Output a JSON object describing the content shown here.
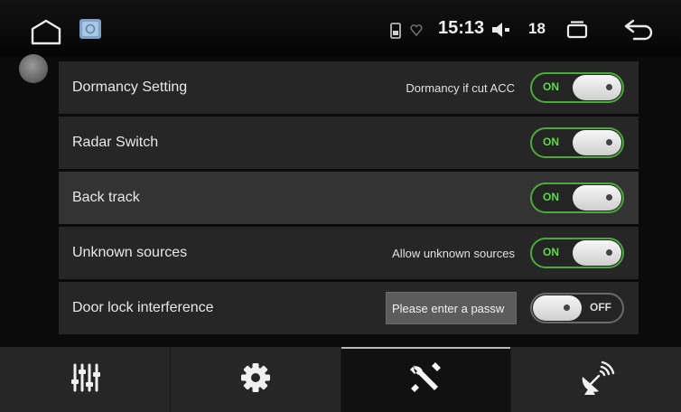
{
  "status_bar": {
    "time": "15:13",
    "volume": "18",
    "icons": [
      "home-icon",
      "app-icon",
      "sim-icon",
      "heart-icon",
      "speaker-icon",
      "recent-apps-icon",
      "back-icon"
    ]
  },
  "settings": {
    "rows": [
      {
        "label": "Dormancy Setting",
        "hint": "Dormancy if cut ACC",
        "toggle": "ON"
      },
      {
        "label": "Radar Switch",
        "toggle": "ON"
      },
      {
        "label": "Back track",
        "toggle": "ON"
      },
      {
        "label": "Unknown sources",
        "hint": "Allow unknown sources",
        "toggle": "ON"
      },
      {
        "label": "Door lock interference",
        "placeholder": "Please enter a passw",
        "toggle": "OFF"
      }
    ]
  },
  "tabs": [
    {
      "icon": "equalizer-icon"
    },
    {
      "icon": "gear-icon"
    },
    {
      "icon": "tools-icon"
    },
    {
      "icon": "satellite-dish-icon"
    }
  ],
  "colors": {
    "toggle_on": "#5fd94a",
    "toggle_border_on": "#4caa3c",
    "row_bg": "#262626",
    "row_highlight_bg": "#333333"
  }
}
